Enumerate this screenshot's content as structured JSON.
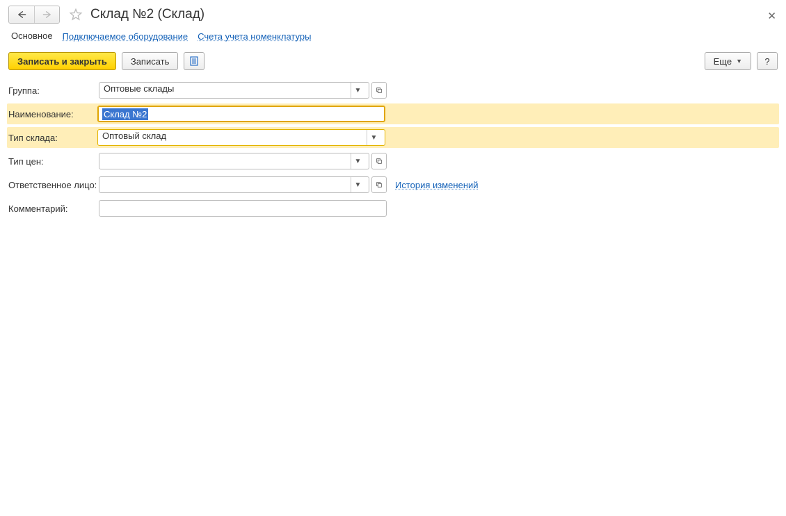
{
  "header": {
    "title": "Склад №2 (Склад)"
  },
  "tabs": {
    "main": "Основное",
    "equipment": "Подключаемое оборудование",
    "accounts": "Счета учета номенклатуры"
  },
  "toolbar": {
    "save_close": "Записать и закрыть",
    "save": "Записать",
    "more": "Еще",
    "help": "?"
  },
  "form": {
    "group_label": "Группа:",
    "group_value": "Оптовые склады",
    "name_label": "Наименование:",
    "name_value": "Склад №2",
    "type_label": "Тип склада:",
    "type_value": "Оптовый склад",
    "price_type_label": "Тип цен:",
    "price_type_value": "",
    "responsible_label": "Ответственное лицо:",
    "responsible_value": "",
    "history_link": "История изменений",
    "comment_label": "Комментарий:",
    "comment_value": ""
  }
}
